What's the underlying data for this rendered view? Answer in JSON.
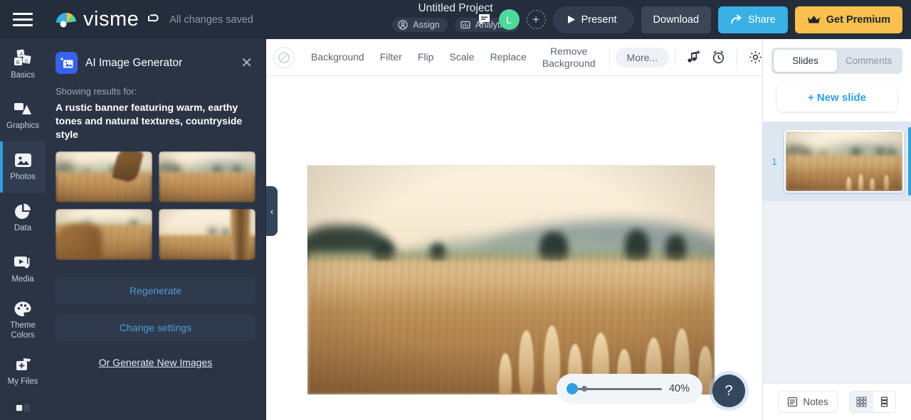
{
  "header": {
    "menu_icon": "hamburger-menu-icon",
    "brand": "visme",
    "undo_icon": "undo-icon",
    "saved_status": "All changes saved",
    "project_title": "Untitled Project",
    "assign_label": "Assign",
    "assign_icon": "assign-person-icon",
    "analytics_label": "Analytics",
    "analytics_icon": "analytics-chart-icon",
    "comment_icon": "comment-icon",
    "avatar_initial": "L",
    "add_collaborator_icon": "add-user-plus-icon",
    "present_label": "Present",
    "present_icon": "play-icon",
    "download_label": "Download",
    "share_label": "Share",
    "share_icon": "share-arrow-icon",
    "premium_label": "Get Premium",
    "premium_icon": "crown-icon"
  },
  "colors": {
    "header_bg": "#242d3c",
    "panel_bg": "#2b3445",
    "accent_blue": "#2f9fe0",
    "share_blue": "#38b0e3",
    "premium_yellow": "#f9c04c",
    "avatar_green": "#4ed99a",
    "ai_icon_blue": "#3563e9",
    "link_blue": "#4e9ed4"
  },
  "sidebar": {
    "items": [
      {
        "label": "Basics",
        "icon": "basics-blocks-icon",
        "active": false
      },
      {
        "label": "Graphics",
        "icon": "graphics-shapes-icon",
        "active": false
      },
      {
        "label": "Photos",
        "icon": "photos-image-icon",
        "active": true
      },
      {
        "label": "Data",
        "icon": "data-piechart-icon",
        "active": false
      },
      {
        "label": "Media",
        "icon": "media-video-icon",
        "active": false
      },
      {
        "label": "Theme Colors",
        "icon": "theme-palette-icon",
        "active": false
      },
      {
        "label": "My Files",
        "icon": "my-files-folder-icon",
        "active": false
      }
    ]
  },
  "ai_panel": {
    "icon": "ai-image-generator-icon",
    "title": "AI Image Generator",
    "close_icon": "close-icon",
    "showing_label": "Showing results for:",
    "prompt": "A rustic banner featuring warm, earthy tones and natural textures, countryside style",
    "results": [
      {
        "name": "wheat-field-result-1"
      },
      {
        "name": "wheat-field-result-2"
      },
      {
        "name": "wheat-field-result-3"
      },
      {
        "name": "wheat-field-result-4"
      }
    ],
    "regenerate_label": "Regenerate",
    "change_settings_label": "Change settings",
    "generate_new_label": "Or Generate New Images"
  },
  "canvas": {
    "collapse_icon": "chevron-left-icon",
    "toolbar": {
      "nofill_icon": "no-fill-icon",
      "items": [
        {
          "label": "Background",
          "name": "background"
        },
        {
          "label": "Filter",
          "name": "filter"
        },
        {
          "label": "Flip",
          "name": "flip"
        },
        {
          "label": "Scale",
          "name": "scale"
        },
        {
          "label": "Replace",
          "name": "replace"
        },
        {
          "label": "Remove\nBackground",
          "name": "remove-background"
        }
      ],
      "more_label": "More...",
      "icons": [
        {
          "name": "add-audio-icon"
        },
        {
          "name": "timer-alarm-icon"
        },
        {
          "name": "settings-gear-icon"
        },
        {
          "name": "search-zoom-icon"
        }
      ]
    },
    "zoom_value": "40%",
    "help_label": "?"
  },
  "right_panel": {
    "tabs": [
      {
        "label": "Slides",
        "active": true
      },
      {
        "label": "Comments",
        "active": false
      }
    ],
    "new_slide_label": "+ New slide",
    "slides": [
      {
        "number": "1",
        "name": "slide-thumbnail-1",
        "selected": true
      }
    ],
    "notes_label": "Notes",
    "notes_icon": "notes-icon",
    "view_grid_icon": "grid-view-icon",
    "view_list_icon": "list-view-icon"
  }
}
